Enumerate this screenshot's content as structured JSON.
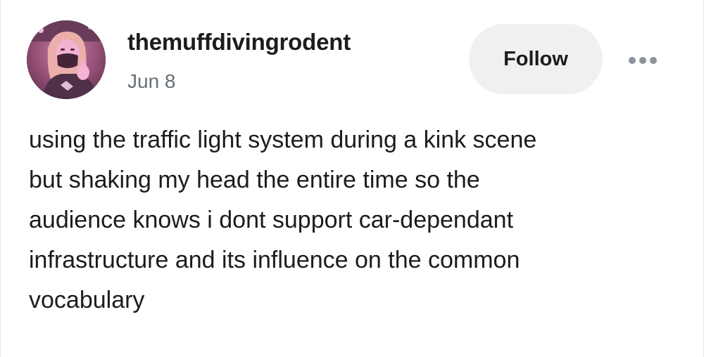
{
  "post": {
    "username": "themuffdivingrodent",
    "date": "Jun 8",
    "follow_label": "Follow",
    "more_icon": "more-horizontal-icon",
    "avatar_icon": "user-avatar",
    "body_lines": [
      "using the traffic light system during a kink scene",
      "but shaking my head the entire time so the",
      "audience knows i dont support car-dependant",
      "infrastructure and its influence on the common",
      "vocabulary"
    ]
  },
  "colors": {
    "background": "#ffffff",
    "text": "#1c1c1c",
    "date_text": "#666f78",
    "follow_bg": "#f0f0f0",
    "dots": "#8a939b"
  }
}
